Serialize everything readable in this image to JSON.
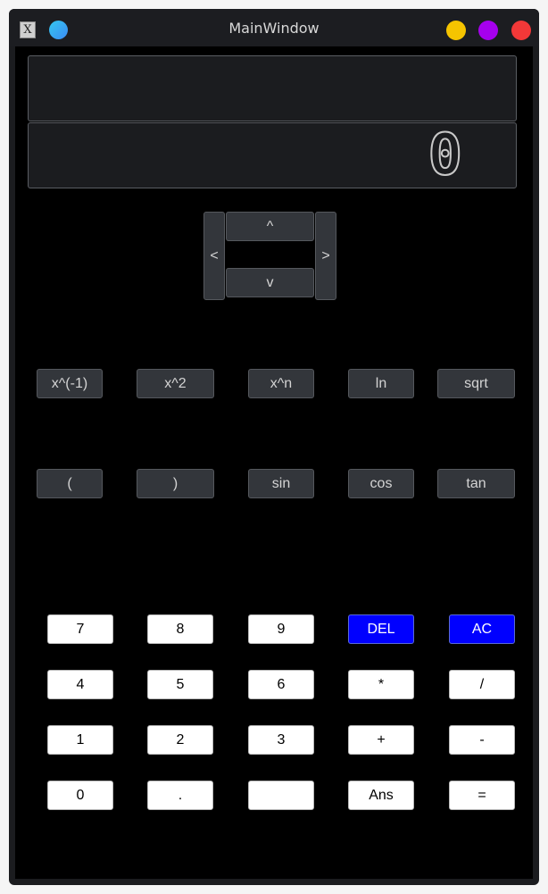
{
  "window": {
    "title": "MainWindow"
  },
  "display": {
    "expression": "",
    "result": "0"
  },
  "nav": {
    "up": "^",
    "down": "v",
    "left": "<",
    "right": ">"
  },
  "functions": {
    "row1": [
      "x^(-1)",
      "x^2",
      "x^n",
      "ln",
      "sqrt"
    ],
    "row2": [
      "(",
      ")",
      "sin",
      "cos",
      "tan"
    ]
  },
  "keypad": {
    "row1": [
      "7",
      "8",
      "9",
      "DEL",
      "AC"
    ],
    "row2": [
      "4",
      "5",
      "6",
      "*",
      "/"
    ],
    "row3": [
      "1",
      "2",
      "3",
      "+",
      "-"
    ],
    "row4": [
      "0",
      ".",
      "",
      "Ans",
      "="
    ]
  },
  "colors": {
    "accent_buttons": "#0000ff",
    "minimize": "#f5c400",
    "maximize": "#a600ee",
    "close": "#f23838"
  }
}
